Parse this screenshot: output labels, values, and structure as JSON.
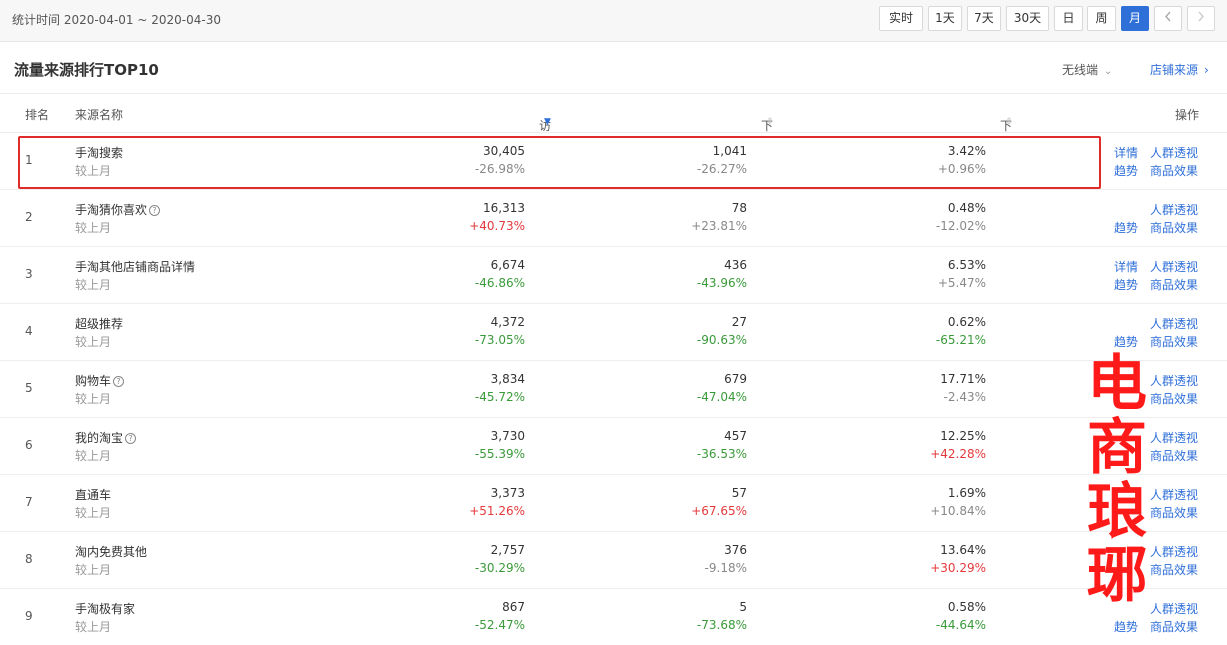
{
  "header": {
    "period_text": "统计时间 2020-04-01 ~ 2020-04-30",
    "buttons": [
      "实时",
      "1天",
      "7天",
      "30天",
      "日",
      "周",
      "月"
    ],
    "prev_icon": "chevron-left-icon",
    "next_icon": "chevron-right-icon",
    "active_button": "月",
    "accent": "#2f6fd8"
  },
  "section": {
    "title": "流量来源排行TOP10",
    "device_label": "无线端",
    "source_link": "店铺来源"
  },
  "table": {
    "columns": {
      "rank": "排名",
      "name": "来源名称",
      "visitors": "访客数",
      "buyers": "下单买家数",
      "conversion": "下单转化率",
      "actions": "操作"
    },
    "compare_label": "较上月",
    "rows": [
      {
        "rank": "1",
        "name": "手淘搜索",
        "help": false,
        "visitors": "30,405",
        "visitors_change": "-26.98%",
        "buyers": "1,041",
        "buyers_change": "-26.27%",
        "conversion": "3.42%",
        "conversion_change": "+0.96%",
        "links": [
          "详情",
          "人群透视",
          "趋势",
          "商品效果"
        ]
      },
      {
        "rank": "2",
        "name": "手淘猜你喜欢",
        "help": true,
        "visitors": "16,313",
        "visitors_change": "+40.73%",
        "buyers": "78",
        "buyers_change": "+23.81%",
        "conversion": "0.48%",
        "conversion_change": "-12.02%",
        "links": [
          "",
          "人群透视",
          "趋势",
          "商品效果"
        ]
      },
      {
        "rank": "3",
        "name": "手淘其他店铺商品详情",
        "help": false,
        "visitors": "6,674",
        "visitors_change": "-46.86%",
        "buyers": "436",
        "buyers_change": "-43.96%",
        "conversion": "6.53%",
        "conversion_change": "+5.47%",
        "links": [
          "详情",
          "人群透视",
          "趋势",
          "商品效果"
        ]
      },
      {
        "rank": "4",
        "name": "超级推荐",
        "help": false,
        "visitors": "4,372",
        "visitors_change": "-73.05%",
        "buyers": "27",
        "buyers_change": "-90.63%",
        "conversion": "0.62%",
        "conversion_change": "-65.21%",
        "links": [
          "",
          "人群透视",
          "趋势",
          "商品效果"
        ]
      },
      {
        "rank": "5",
        "name": "购物车",
        "help": true,
        "visitors": "3,834",
        "visitors_change": "-45.72%",
        "buyers": "679",
        "buyers_change": "-47.04%",
        "conversion": "17.71%",
        "conversion_change": "-2.43%",
        "links": [
          "",
          "人群透视",
          "",
          "商品效果"
        ]
      },
      {
        "rank": "6",
        "name": "我的淘宝",
        "help": true,
        "visitors": "3,730",
        "visitors_change": "-55.39%",
        "buyers": "457",
        "buyers_change": "-36.53%",
        "conversion": "12.25%",
        "conversion_change": "+42.28%",
        "links": [
          "",
          "人群透视",
          "",
          "商品效果"
        ]
      },
      {
        "rank": "7",
        "name": "直通车",
        "help": false,
        "visitors": "3,373",
        "visitors_change": "+51.26%",
        "buyers": "57",
        "buyers_change": "+67.65%",
        "conversion": "1.69%",
        "conversion_change": "+10.84%",
        "links": [
          "",
          "人群透视",
          "",
          "商品效果"
        ]
      },
      {
        "rank": "8",
        "name": "淘内免费其他",
        "help": false,
        "visitors": "2,757",
        "visitors_change": "-30.29%",
        "buyers": "376",
        "buyers_change": "-9.18%",
        "conversion": "13.64%",
        "conversion_change": "+30.29%",
        "links": [
          "",
          "人群透视",
          "",
          "商品效果"
        ]
      },
      {
        "rank": "9",
        "name": "手淘极有家",
        "help": false,
        "visitors": "867",
        "visitors_change": "-52.47%",
        "buyers": "5",
        "buyers_change": "-73.68%",
        "conversion": "0.58%",
        "conversion_change": "-44.64%",
        "links": [
          "",
          "人群透视",
          "趋势",
          "商品效果"
        ]
      }
    ]
  },
  "watermark": {
    "text": [
      "电",
      "商",
      "琅",
      "琊"
    ],
    "color": "#ff1a1a"
  },
  "colors": {
    "increase": "#e4393c",
    "decrease": "#3a9a3a",
    "highlight_border": "#e02b2b"
  }
}
